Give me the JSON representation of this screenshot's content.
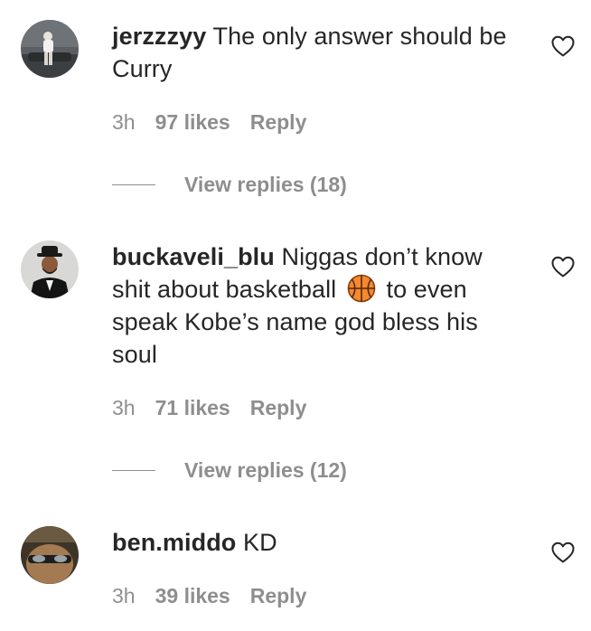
{
  "comments": [
    {
      "username": "jerzzzyy",
      "text": " The only answer should be Curry",
      "time": "3h",
      "likes": "97 likes",
      "reply": "Reply",
      "view_replies": "View replies (18)",
      "avatar_icon": "avatar-photo-jerzzzyy",
      "heart_icon": "heart-outline-icon"
    },
    {
      "username": "buckaveli_blu",
      "text_before": " Niggas don’t know shit about basketball",
      "emoji": "🏀",
      "text_after": " to even speak Kobe’s name god bless his soul",
      "time": "3h",
      "likes": "71 likes",
      "reply": "Reply",
      "view_replies": "View replies (12)",
      "avatar_icon": "avatar-photo-buckaveli_blu",
      "heart_icon": "heart-outline-icon"
    },
    {
      "username": "ben.middo",
      "text": " KD",
      "time": "3h",
      "likes": "39 likes",
      "reply": "Reply",
      "avatar_icon": "avatar-photo-ben.middo",
      "heart_icon": "heart-outline-icon"
    }
  ],
  "colors": {
    "text_primary": "#262626",
    "text_secondary": "#8e8e8e",
    "background": "#ffffff"
  }
}
